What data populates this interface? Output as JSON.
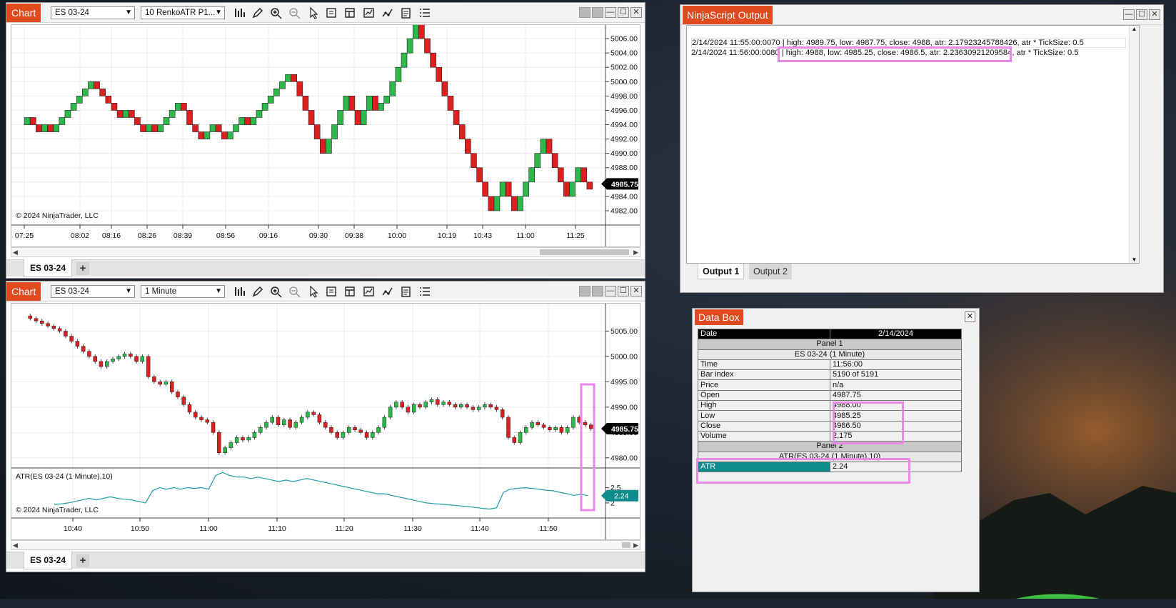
{
  "colors": {
    "accent": "#e04a1f",
    "bull": "#2db84a",
    "bear": "#dd1f1f",
    "atr_line": "#1f9ea8",
    "atr_badge": "#0f8b8d",
    "highlight": "#e98ae9"
  },
  "icons": [
    "bar-chart-icon",
    "pencil-icon",
    "zoom-in-icon",
    "zoom-out-icon",
    "pointer-icon",
    "properties-icon",
    "templates-icon",
    "indicators-icon",
    "strategies-icon",
    "data-box-icon",
    "more-icon"
  ],
  "chart1": {
    "app_label": "Chart",
    "instrument": "ES 03-24",
    "bar_type": "10 RenkoATR P1...",
    "price_label": "4985.75",
    "copyright": "© 2024 NinjaTrader, LLC",
    "tab": "ES 03-24",
    "y_ticks": [
      "5006.00",
      "5004.00",
      "5002.00",
      "5000.00",
      "4998.00",
      "4996.00",
      "4994.00",
      "4992.00",
      "4990.00",
      "4988.00",
      "4986.00",
      "4984.00",
      "4982.00"
    ],
    "x_ticks": [
      "07:25",
      "08:02",
      "08:16",
      "08:26",
      "08:39",
      "08:56",
      "09:16",
      "09:30",
      "09:38",
      "10:00",
      "10:19",
      "10:43",
      "11:00",
      "11:25"
    ]
  },
  "chart2": {
    "app_label": "Chart",
    "instrument": "ES 03-24",
    "bar_type": "1 Minute",
    "price_label": "4985.75",
    "atr_label": "2.24",
    "indicator_title": "ATR(ES 03-24 (1 Minute),10)",
    "copyright": "© 2024 NinjaTrader, LLC",
    "tab": "ES 03-24",
    "y_ticks": [
      "5005.00",
      "5000.00",
      "4995.00",
      "4990.00",
      "4985.00",
      "4980.00"
    ],
    "atr_ticks": [
      "2.5",
      "2"
    ],
    "x_ticks": [
      "10:40",
      "10:50",
      "11:00",
      "11:10",
      "11:20",
      "11:30",
      "11:40",
      "11:50"
    ]
  },
  "output": {
    "title": "NinjaScript Output",
    "line1_time": "2/14/2024 11:55:00",
    "line1_rest": ":0070 | high: 4989.75, low: 4987.75, close: 4988, atr: 2.17923245788426, atr * TickSize: 0.5",
    "line2_time": "2/14/2024 11:56:00:0080",
    "line2_rest": "| high: 4988, low: 4985.25, close: 4986.5, atr: 2.23630921209584, atr * TickSize: 0.5",
    "tabs": [
      "Output 1",
      "Output 2"
    ]
  },
  "databox": {
    "title": "Data Box",
    "date_label": "Date",
    "date_value": "2/14/2024",
    "panel1": "Panel 1",
    "series1": "ES 03-24 (1 Minute)",
    "rows": [
      {
        "label": "Time",
        "value": "11:56:00"
      },
      {
        "label": "Bar index",
        "value": "5190 of 5191"
      },
      {
        "label": "Price",
        "value": "n/a"
      },
      {
        "label": "Open",
        "value": "4987.75"
      },
      {
        "label": "High",
        "value": "4988.00"
      },
      {
        "label": "Low",
        "value": "4985.25"
      },
      {
        "label": "Close",
        "value": "4986.50"
      },
      {
        "label": "Volume",
        "value": "2,175"
      }
    ],
    "panel2": "Panel 2",
    "series2": "ATR(ES 03-24 (1 Minute),10)",
    "atr_label": "ATR",
    "atr_value": "2.24"
  }
}
